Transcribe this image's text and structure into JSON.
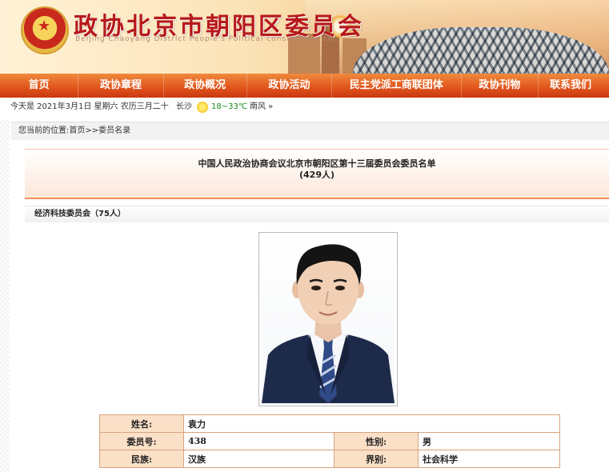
{
  "header": {
    "title": "政协北京市朝阳区委员会",
    "subtitle": "Beijing Chaoyang District People's Political consultative co"
  },
  "nav": {
    "items": [
      "首页",
      "政协章程",
      "政协概况",
      "政协活动",
      "民主党派工商联团体",
      "政协刊物",
      "联系我们"
    ]
  },
  "infobar": {
    "date_text": "今天是 2021年3月1日 星期六 农历三月二十",
    "city": "长沙",
    "temperature": "18~33℃",
    "wind": "南风 »"
  },
  "breadcrumb": "您当前的位置:首页>>委员名录",
  "list_title": {
    "line1": "中国人民政治协商会议北京市朝阳区第十三届委员会委员名单",
    "line2": "(429人)"
  },
  "committee": "经济科技委员会（75人）",
  "member": {
    "name_label": "姓名:",
    "name": "袁力",
    "id_label": "委员号:",
    "id": "438",
    "gender_label": "性别:",
    "gender": "男",
    "ethnicity_label": "民族:",
    "ethnicity": "汉族",
    "sector_label": "界别:",
    "sector": "社会科学"
  },
  "colors": {
    "nav_orange": "#e0531c",
    "title_red": "#b7181b",
    "table_border": "#d7a27b",
    "label_bg": "#fbe0c8"
  }
}
